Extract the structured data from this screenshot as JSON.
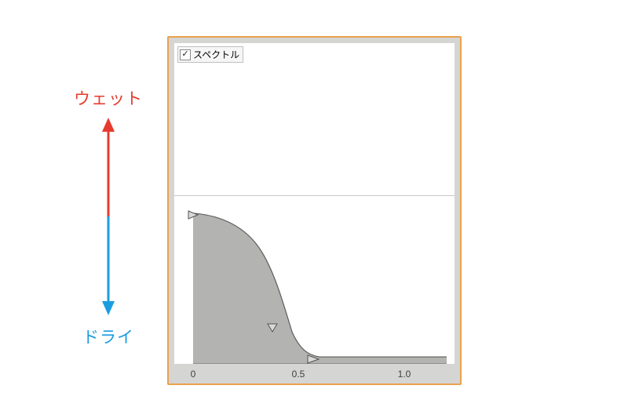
{
  "annotations": {
    "wet": "ウェット",
    "dry": "ドライ"
  },
  "legend": {
    "checked": true,
    "label": "スペクトル"
  },
  "axis": {
    "ticks": [
      "0",
      "0.5",
      "1.0"
    ]
  },
  "colors": {
    "wet": "#e53b2e",
    "dry": "#1a9de0",
    "panel_border": "#e8a24d",
    "panel_bg": "#d5d5d3",
    "fill": "#b3b3b1",
    "stroke": "#5d5d5d"
  },
  "chart_data": {
    "type": "area",
    "title": "",
    "xlabel": "",
    "ylabel": "",
    "xlim": [
      0,
      1.2
    ],
    "ylim": [
      0,
      1.0
    ],
    "grid": "midline",
    "legend_label": "スペクトル",
    "y_axis_meaning": {
      "top": "ウェット",
      "bottom": "ドライ"
    },
    "x": [
      0.0,
      0.05,
      0.1,
      0.15,
      0.2,
      0.25,
      0.3,
      0.35,
      0.4,
      0.45,
      0.5,
      0.55,
      0.6,
      0.7,
      0.8,
      1.0,
      1.2
    ],
    "values": [
      0.53,
      0.52,
      0.5,
      0.47,
      0.42,
      0.35,
      0.26,
      0.17,
      0.1,
      0.06,
      0.04,
      0.03,
      0.02,
      0.02,
      0.02,
      0.02,
      0.02
    ],
    "control_handles_x": [
      0.0,
      0.38,
      0.55
    ]
  }
}
